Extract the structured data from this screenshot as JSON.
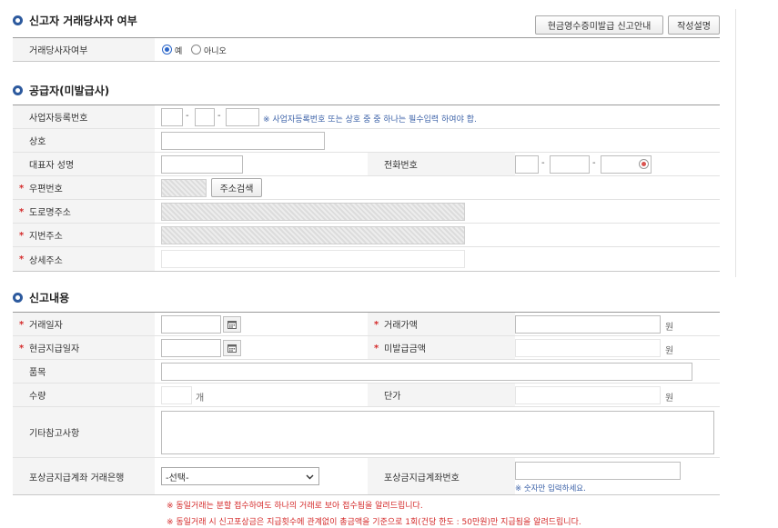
{
  "section1": {
    "title": "신고자 거래당사자 여부",
    "guide_button": "현금영수증미발급 신고안내",
    "write_button": "작성설명",
    "party_label": "거래당사자여부",
    "radio_yes": "예",
    "radio_no": "아니오",
    "selected": "yes"
  },
  "section2": {
    "title": "공급자(미발급사)",
    "bizno_label": "사업자등록번호",
    "dash": "-",
    "bizno_hint": "※ 사업자등록번호 또는 상호 중 중 하나는 필수입력 하여야 합.",
    "company_label": "상호",
    "ceo_label": "대표자 성명",
    "phone_label": "전화번호",
    "postal_label": "우편번호",
    "address_search_button": "주소검색",
    "road_address_label": "도로명주소",
    "lot_address_label": "지번주소",
    "detail_address_label": "상세주소"
  },
  "section3": {
    "title": "신고내용",
    "trade_date_label": "거래일자",
    "trade_amount_label": "거래가액",
    "won": "원",
    "cash_pay_date_label": "현금지급일자",
    "unissued_amount_label": "미발급금액",
    "item_label": "품목",
    "qty_label": "수량",
    "qty_unit": "개",
    "unit_price_label": "단가",
    "notes_label": "기타참고사항",
    "bank_label": "포상금지급계좌 거래은행",
    "bank_select": "-선택-",
    "account_label": "포상금지급계좌번호",
    "account_hint": "※ 숫자만 입력하세요."
  },
  "notes": [
    "※ 동일거래는 분할 접수하여도 하나의 거래로 보아 접수됨을 알려드립니다.",
    "※ 동일거래 시 신고포상금은 지급횟수에 관계없이 총금액을 기준으로 1회(건당 한도 : 50만원)만 지급됨을 알려드립니다."
  ]
}
